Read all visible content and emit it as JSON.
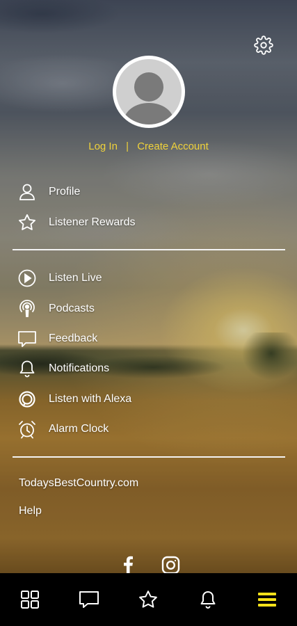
{
  "auth": {
    "login_label": "Log In",
    "separator": "|",
    "create_account_label": "Create Account",
    "link_color": "#f0d23a"
  },
  "menu": {
    "section1": [
      {
        "label": "Profile",
        "icon": "person-icon"
      },
      {
        "label": "Listener Rewards",
        "icon": "star-outline-icon"
      }
    ],
    "section2": [
      {
        "label": "Listen Live",
        "icon": "play-circle-icon"
      },
      {
        "label": "Podcasts",
        "icon": "podcast-icon"
      },
      {
        "label": "Feedback",
        "icon": "chat-bubble-icon"
      },
      {
        "label": "Notifications",
        "icon": "bell-icon"
      },
      {
        "label": "Listen with Alexa",
        "icon": "alexa-icon"
      },
      {
        "label": "Alarm Clock",
        "icon": "alarm-clock-icon"
      }
    ]
  },
  "links": {
    "website": "TodaysBestCountry.com",
    "help": "Help"
  },
  "social": [
    "facebook-icon",
    "instagram-icon"
  ],
  "tabbar": {
    "items": [
      "grid-icon",
      "chat-bubble-icon",
      "star-outline-icon",
      "bell-icon",
      "hamburger-menu-icon"
    ],
    "active": "hamburger-menu-icon",
    "active_color": "#f6e21a"
  }
}
